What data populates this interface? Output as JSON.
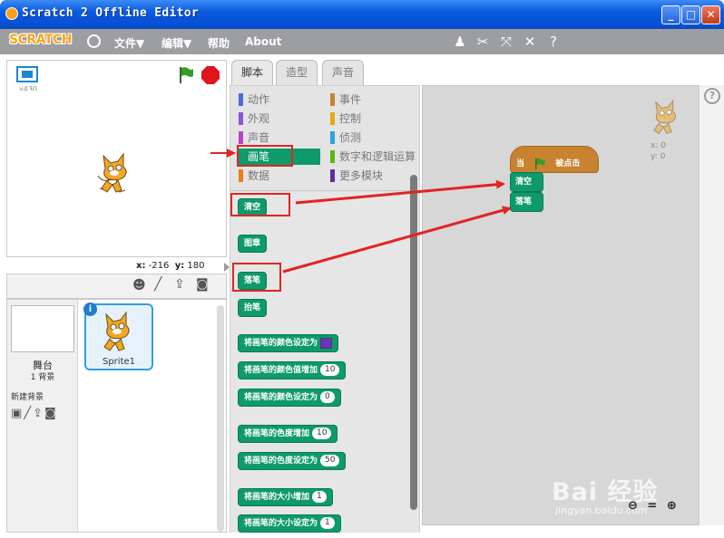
{
  "window": {
    "title": "Scratch 2 Offline Editor",
    "minimize": "_",
    "maximize": "□",
    "close": "✕"
  },
  "menubar": {
    "logo": "SCRATCH",
    "file": "文件▼",
    "edit": "编辑▼",
    "help": "帮助",
    "about": "About",
    "tools": [
      "stamp-icon",
      "cut-icon",
      "grow-icon",
      "shrink-icon",
      "help-icon"
    ]
  },
  "stage": {
    "version": "v430",
    "x_label": "x:",
    "x_value": "-216",
    "y_label": "y:",
    "y_value": "180"
  },
  "sprites": {
    "stage_label": "舞台",
    "backdrop_count": "1 背景",
    "new_backdrop": "新建背景",
    "sprite_name": "Sprite1",
    "info": "i"
  },
  "tabs": {
    "scripts": "脚本",
    "costumes": "造型",
    "sounds": "声音"
  },
  "categories": [
    {
      "label": "动作",
      "color": "#4a6cd4"
    },
    {
      "label": "外观",
      "color": "#8a55d7"
    },
    {
      "label": "声音",
      "color": "#bb42c3"
    },
    {
      "label": "画笔",
      "color": "#0e9a6c"
    },
    {
      "label": "数据",
      "color": "#ee7d16"
    },
    {
      "label": "事件",
      "color": "#c88330"
    },
    {
      "label": "控制",
      "color": "#e1a91a"
    },
    {
      "label": "侦测",
      "color": "#2ca5e2"
    },
    {
      "label": "数字和逻辑运算",
      "color": "#5cb712"
    },
    {
      "label": "更多模块",
      "color": "#632d99"
    }
  ],
  "palette_blocks": {
    "clear": "清空",
    "stamp": "图章",
    "pen_down": "落笔",
    "pen_up": "抬笔",
    "set_color_to": "将画笔的颜色设定为",
    "change_color_by": "将画笔的颜色值增加",
    "change_color_val": "10",
    "set_color_value": "将画笔的颜色设定为",
    "set_color_value_val": "0",
    "change_shade_by": "将画笔的色度增加",
    "change_shade_val": "10",
    "set_shade_to": "将画笔的色度设定为",
    "set_shade_val": "50",
    "change_size_by": "将画笔的大小增加",
    "change_size_val": "1",
    "set_size_to": "将画笔的大小设定为",
    "set_size_val": "1"
  },
  "script": {
    "hat_prefix": "当",
    "hat_suffix": "被点击",
    "block1": "清空",
    "block2": "落笔",
    "sprite_x": "x: 0",
    "sprite_y": "y: 0",
    "zoom": "⊖ = ⊕",
    "watermark": "Bai 经验",
    "watermark_url": "jingyan.baidu.com"
  },
  "help": "?"
}
